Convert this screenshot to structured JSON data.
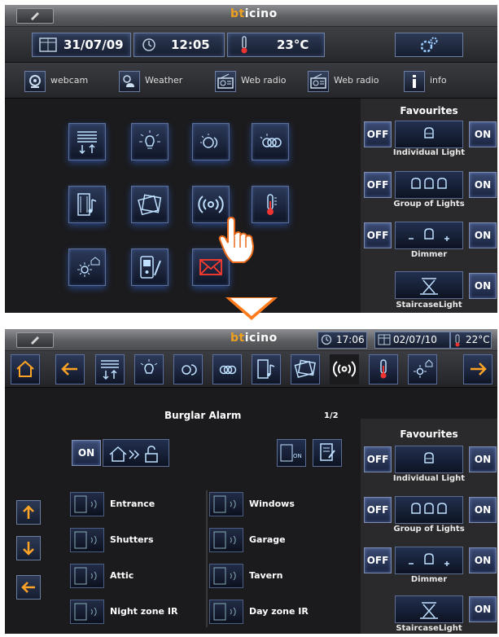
{
  "brand": {
    "prefix": "bt",
    "suffix": "icino"
  },
  "top": {
    "date": "31/07/09",
    "time": "12:05",
    "temperature": "23°C",
    "links": [
      {
        "label": "webcam",
        "icon": "webcam-icon"
      },
      {
        "label": "Weather",
        "icon": "weather-icon"
      },
      {
        "label": "Web radio",
        "icon": "radio-icon"
      },
      {
        "label": "Web radio",
        "icon": "radio-icon"
      },
      {
        "label": "info",
        "icon": "info-icon"
      }
    ],
    "grid": [
      {
        "icon": "shutters-icon"
      },
      {
        "icon": "lighting-icon"
      },
      {
        "icon": "scenarios-icon"
      },
      {
        "icon": "scenarios-multi-icon"
      },
      {
        "icon": "audio-icon"
      },
      {
        "icon": "multimedia-icon"
      },
      {
        "icon": "burglar-alarm-icon"
      },
      {
        "icon": "thermometer-icon"
      },
      {
        "icon": "energy-icon"
      },
      {
        "icon": "door-entry-icon"
      },
      {
        "icon": "messages-icon"
      }
    ]
  },
  "favourites": {
    "title": "Favourites",
    "on_label": "ON",
    "off_label": "OFF",
    "items": [
      {
        "name": "Individual Light",
        "has_off": true
      },
      {
        "name": "Group of Lights",
        "has_off": true
      },
      {
        "name": "Dimmer",
        "has_off": true
      },
      {
        "name": "StaircaseLight",
        "has_off": false
      }
    ]
  },
  "bottom": {
    "time": "17:06",
    "date": "02/07/10",
    "temperature": "22°C",
    "section_title": "Burglar Alarm",
    "page": "1/2",
    "on_label": "ON",
    "zones_left": [
      "Entrance",
      "Shutters",
      "Attic",
      "Night zone IR"
    ],
    "zones_right": [
      "Windows",
      "Garage",
      "Tavern",
      "Day zone IR"
    ]
  },
  "colors": {
    "accent": "#f0a020",
    "button_blue": "#2c3a5a",
    "panel": "#1b1b1d"
  }
}
